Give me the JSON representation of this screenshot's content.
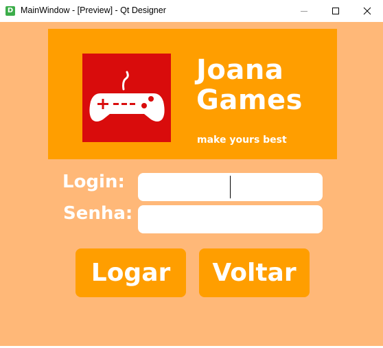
{
  "window": {
    "title": "MainWindow - [Preview] - Qt Designer",
    "app_icon_letter": "D",
    "controls": {
      "minimize": "minimize-icon",
      "maximize": "maximize-icon",
      "close": "close-icon"
    }
  },
  "banner": {
    "brand_line_1": "Joana",
    "brand_line_2": "Games",
    "tagline": "make yours best",
    "logo_icon": "gamepad-icon"
  },
  "form": {
    "login_label": "Login:",
    "login_value": "",
    "senha_label": "Senha:",
    "senha_value": ""
  },
  "buttons": {
    "logar": "Logar",
    "voltar": "Voltar"
  },
  "colors": {
    "background": "#ffb878",
    "banner": "#ff9e00",
    "logo_bg": "#d90c0c",
    "button": "#ff9e00",
    "text": "#ffffff"
  }
}
